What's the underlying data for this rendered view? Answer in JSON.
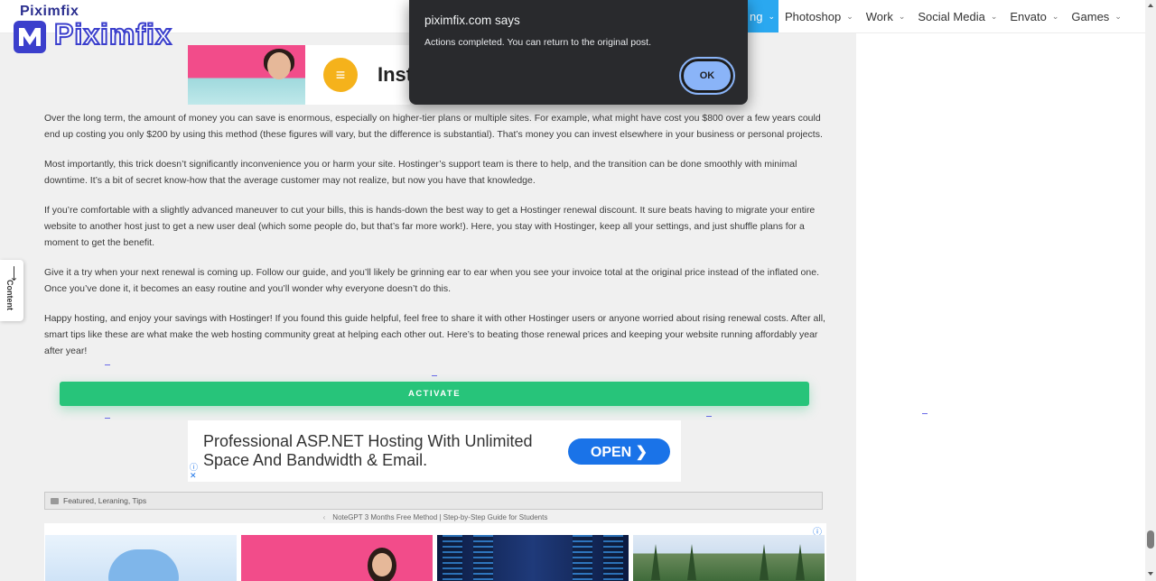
{
  "brand": {
    "name": "Piximfix",
    "small": "Piximfix"
  },
  "nav": {
    "items": [
      {
        "label": "ng",
        "active": true
      },
      {
        "label": "Photoshop"
      },
      {
        "label": "Work"
      },
      {
        "label": "Social Media"
      },
      {
        "label": "Envato"
      },
      {
        "label": "Games"
      }
    ],
    "chevron": "⌄"
  },
  "dialog": {
    "title": "piximfix.com says",
    "message": "Actions completed. You can return to the original post.",
    "ok_label": "OK"
  },
  "ad_top": {
    "text": "Inst",
    "icon": "coin-icon"
  },
  "article": {
    "paragraphs": [
      "Over the long term, the amount of money you can save is enormous, especially on higher-tier plans or multiple sites. For example, what might have cost you $800 over a few years could end up costing you only $200 by using this method (these figures will vary, but the difference is substantial). That’s money you can invest elsewhere in your business or personal projects.",
      "Most importantly, this trick doesn’t significantly inconvenience you or harm your site. Hostinger’s support team is there to help, and the transition can be done smoothly with minimal downtime. It’s a bit of secret know-how that the average customer may not realize, but now you have that knowledge.",
      "If you’re comfortable with a slightly advanced maneuver to cut your bills, this is hands-down the best way to get a Hostinger renewal discount. It sure beats having to migrate your entire website to another host just to get a new user deal (which some people do, but that’s far more work!). Here, you stay with Hostinger, keep all your settings, and just shuffle plans for a moment to get the benefit.",
      "Give it a try when your next renewal is coming up. Follow our guide, and you’ll likely be grinning ear to ear when you see your invoice total at the original price instead of the inflated one. Once you’ve done it, it becomes an easy routine and you’ll wonder why everyone doesn’t do this.",
      "Happy hosting, and enjoy your savings with Hostinger! If you found this guide helpful, feel free to share it with other Hostinger users or anyone worried about rising renewal costs. After all, smart tips like these are what make the web hosting community great at helping each other out. Here’s to beating those renewal prices and keeping your website running affordably year after year!"
    ]
  },
  "activate_label": "ACTIVATE",
  "ad_mid": {
    "line1": "Professional ASP.NET Hosting With Unlimited",
    "line2": "Space And Bandwidth & Email.",
    "button": "OPEN ❯",
    "info": "ⓘ",
    "close": "✕"
  },
  "tags": "Featured, Leraning, Tips",
  "post_nav": {
    "arrow": "‹",
    "prev_title": "NoteGPT 3 Months Free Method | Step-by-Step Guide for Students"
  },
  "thumbs_ad_info": "ⓘ",
  "side_tab": {
    "arrow": "⟶",
    "label": "Content"
  },
  "colors": {
    "accent": "#27c47a",
    "nav_active": "#2aa8f0",
    "dialog_bg": "#292a2d",
    "ok_button": "#8ab4f8",
    "ad_button": "#1a73e8"
  }
}
